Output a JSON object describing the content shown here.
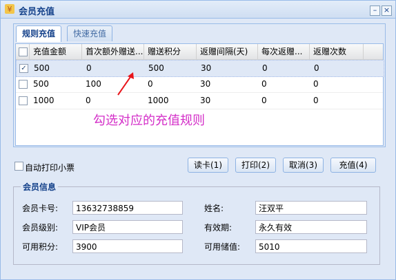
{
  "window": {
    "title": "会员充值"
  },
  "tabs": [
    {
      "label": "规则充值",
      "active": true
    },
    {
      "label": "快速充值",
      "active": false
    }
  ],
  "grid": {
    "columns": [
      "充值金额",
      "首次额外赠送...",
      "赠送积分",
      "返赠间隔(天)",
      "每次返赠...",
      "返赠次数"
    ],
    "rows": [
      {
        "checked": true,
        "cells": [
          "500",
          "0",
          "500",
          "30",
          "0",
          "0"
        ]
      },
      {
        "checked": false,
        "cells": [
          "500",
          "100",
          "0",
          "30",
          "0",
          "0"
        ]
      },
      {
        "checked": false,
        "cells": [
          "1000",
          "0",
          "1000",
          "30",
          "0",
          "0"
        ]
      }
    ]
  },
  "annotation": "勾选对应的充值规则",
  "print_option": "自动打印小票",
  "buttons": {
    "read_card": "读卡(1)",
    "print": "打印(2)",
    "cancel": "取消(3)",
    "recharge": "充值(4)"
  },
  "member_info": {
    "title": "会员信息",
    "card_label": "会员卡号:",
    "card_value": "13632738859",
    "name_label": "姓名:",
    "name_value": "汪双平",
    "level_label": "会员级别:",
    "level_value": "VIP会员",
    "validity_label": "有效期:",
    "validity_value": "永久有效",
    "points_label": "可用积分:",
    "points_value": "3900",
    "balance_label": "可用储值:",
    "balance_value": "5010"
  },
  "colors": {
    "accent": "#15428b",
    "annotation": "#d42ec8",
    "arrow": "#e8151b"
  }
}
